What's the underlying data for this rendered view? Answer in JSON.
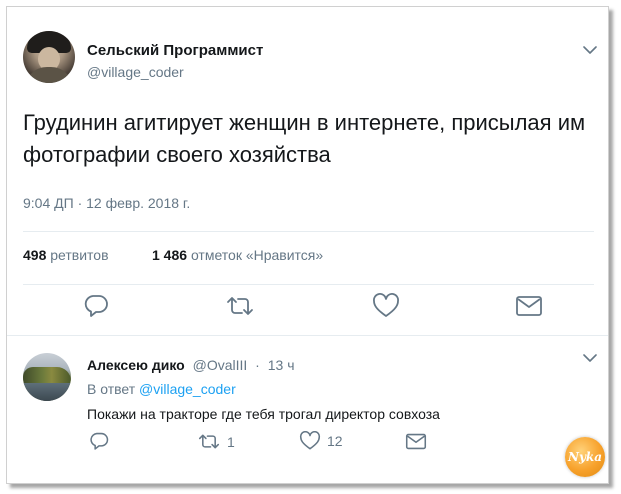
{
  "tweet": {
    "author_name": "Сельский Программист",
    "author_handle": "@village_coder",
    "text": "Грудинин агитирует женщин в интернете, присылая им фотографии своего хозяйства",
    "timestamp": "9:04 ДП · 12 февр. 2018 г.",
    "retweets_count": "498",
    "retweets_label": "ретвитов",
    "likes_count": "1 486",
    "likes_label": "отметок «Нравится»",
    "icons": [
      "avatar",
      "chevron-down-icon",
      "reply-icon",
      "retweet-icon",
      "heart-icon",
      "mail-icon"
    ]
  },
  "reply": {
    "author_name": "Алексею дико",
    "author_handle": "@OvalIII",
    "dot": "·",
    "time": "13 ч",
    "reply_to_prefix": "В ответ",
    "reply_to_mention": "@village_coder",
    "text": "Покажи на тракторе где тебя трогал директор совхоза",
    "retweets_count": "1",
    "likes_count": "12"
  },
  "watermark": {
    "text": "Nyka"
  },
  "colors": {
    "text": "#14171a",
    "muted": "#657786",
    "link": "#1da1f2",
    "icon": "#657786",
    "divider": "#e6ecf0",
    "watermark": "#f7a12b"
  }
}
